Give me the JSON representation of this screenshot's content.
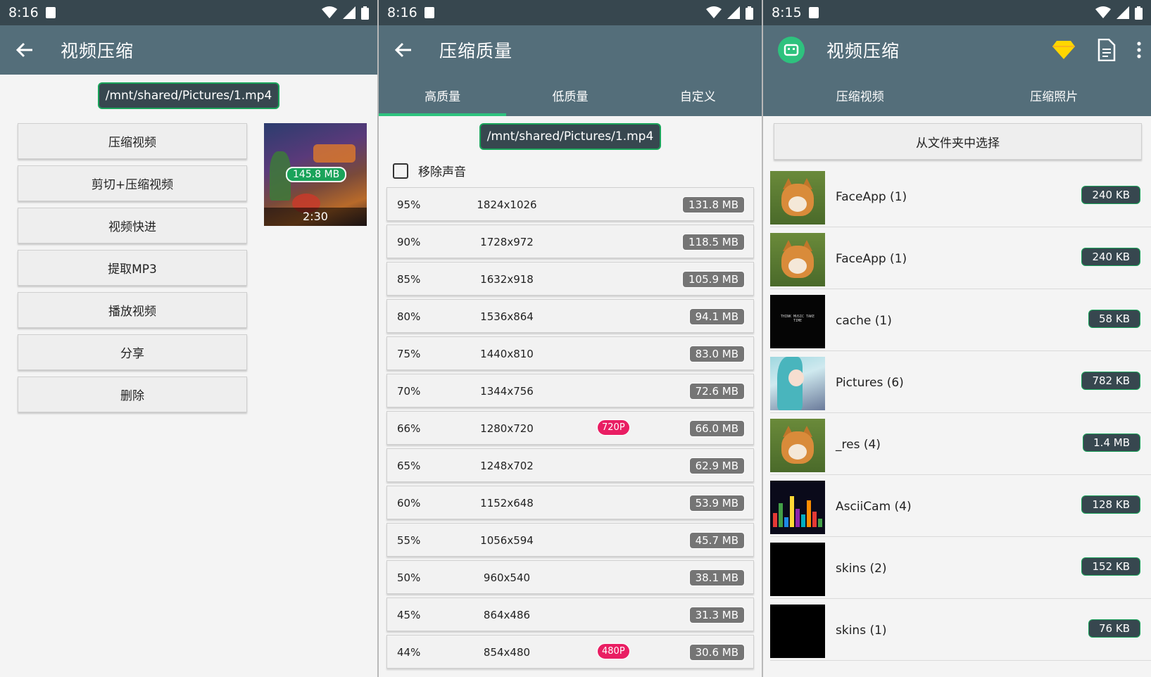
{
  "panel1": {
    "status": {
      "time": "8:16"
    },
    "appbar": {
      "title": "视频压缩"
    },
    "path": "/mnt/shared/Pictures/1.mp4",
    "menu": [
      "压缩视频",
      "剪切+压缩视频",
      "视频快进",
      "提取MP3",
      "播放视频",
      "分享",
      "删除"
    ],
    "video": {
      "size": "145.8 MB",
      "duration": "2:30"
    }
  },
  "panel2": {
    "status": {
      "time": "8:16"
    },
    "appbar": {
      "title": "压缩质量"
    },
    "tabs": [
      "高质量",
      "低质量",
      "自定义"
    ],
    "active_tab": 0,
    "path": "/mnt/shared/Pictures/1.mp4",
    "remove_audio_label": "移除声音",
    "rows": [
      {
        "pct": "95%",
        "res": "1824x1026",
        "badge": "",
        "size": "131.8 MB"
      },
      {
        "pct": "90%",
        "res": "1728x972",
        "badge": "",
        "size": "118.5 MB"
      },
      {
        "pct": "85%",
        "res": "1632x918",
        "badge": "",
        "size": "105.9 MB"
      },
      {
        "pct": "80%",
        "res": "1536x864",
        "badge": "",
        "size": "94.1 MB"
      },
      {
        "pct": "75%",
        "res": "1440x810",
        "badge": "",
        "size": "83.0 MB"
      },
      {
        "pct": "70%",
        "res": "1344x756",
        "badge": "",
        "size": "72.6 MB"
      },
      {
        "pct": "66%",
        "res": "1280x720",
        "badge": "720P",
        "size": "66.0 MB"
      },
      {
        "pct": "65%",
        "res": "1248x702",
        "badge": "",
        "size": "62.9 MB"
      },
      {
        "pct": "60%",
        "res": "1152x648",
        "badge": "",
        "size": "53.9 MB"
      },
      {
        "pct": "55%",
        "res": "1056x594",
        "badge": "",
        "size": "45.7 MB"
      },
      {
        "pct": "50%",
        "res": "960x540",
        "badge": "",
        "size": "38.1 MB"
      },
      {
        "pct": "45%",
        "res": "864x486",
        "badge": "",
        "size": "31.3 MB"
      },
      {
        "pct": "44%",
        "res": "854x480",
        "badge": "480P",
        "size": "30.6 MB"
      }
    ]
  },
  "panel3": {
    "status": {
      "time": "8:15"
    },
    "appbar": {
      "title": "视频压缩"
    },
    "tabs": [
      "压缩视频",
      "压缩照片"
    ],
    "choose_folder_label": "从文件夹中选择",
    "folders": [
      {
        "name": "FaceApp (1)",
        "size": "240 KB",
        "thumb": "dog"
      },
      {
        "name": "FaceApp (1)",
        "size": "240 KB",
        "thumb": "dog"
      },
      {
        "name": "cache (1)",
        "size": "58 KB",
        "thumb": "dark",
        "thumb_text": "THINK MUSIC TAKE TIME"
      },
      {
        "name": "Pictures (6)",
        "size": "782 KB",
        "thumb": "anime"
      },
      {
        "name": "_res (4)",
        "size": "1.4 MB",
        "thumb": "dog"
      },
      {
        "name": "AsciiCam (4)",
        "size": "128 KB",
        "thumb": "ascii"
      },
      {
        "name": "skins (2)",
        "size": "152 KB",
        "thumb": "black"
      },
      {
        "name": "skins (1)",
        "size": "76 KB",
        "thumb": "black"
      }
    ]
  },
  "colors": {
    "statusbar": "#37474f",
    "appbar": "#546e7a",
    "accent_green": "#1aa35a",
    "tab_indicator": "#2ec27e",
    "badge_pink": "#e91e63",
    "size_chip_gray": "#757575"
  }
}
